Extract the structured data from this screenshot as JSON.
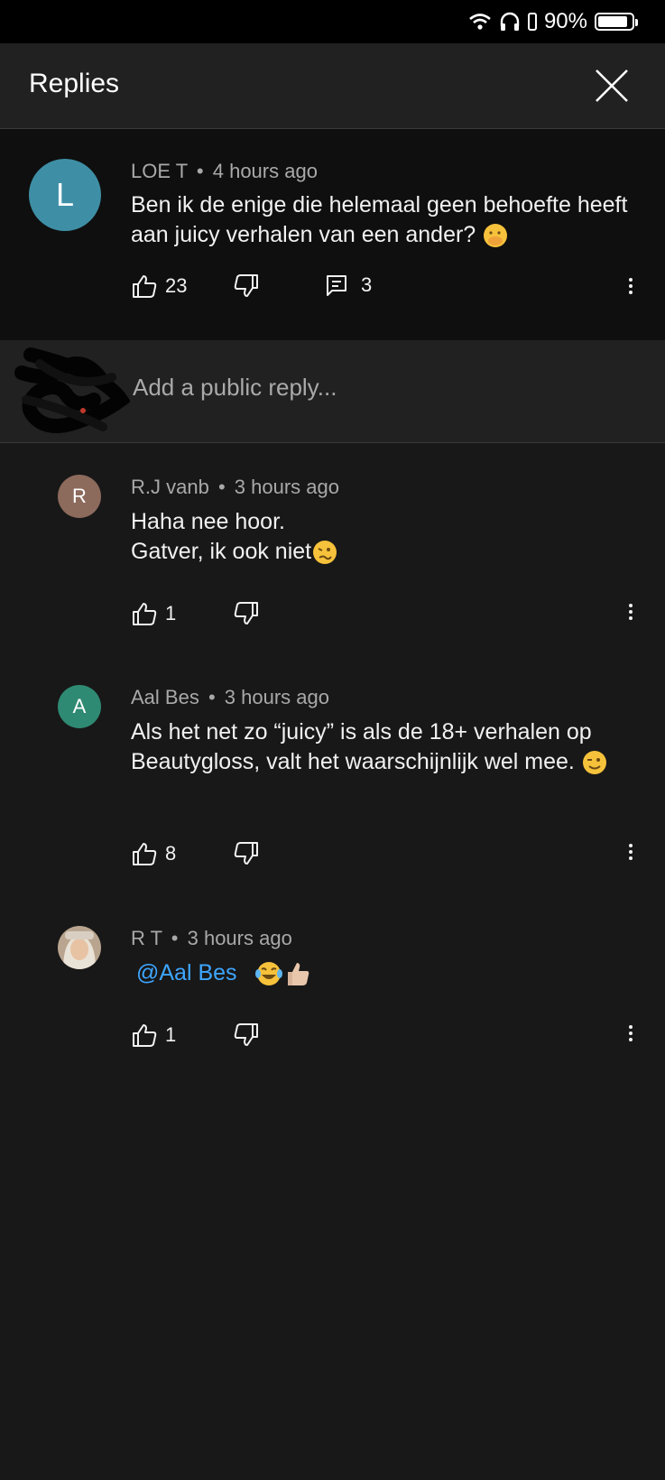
{
  "status": {
    "battery": "90%",
    "battery_level": 0.9
  },
  "header": {
    "title": "Replies"
  },
  "parent_comment": {
    "avatar_letter": "L",
    "avatar_color": "#3e8fa6",
    "author": "LOE T",
    "time": "4 hours ago",
    "text": "Ben ik de enige die helemaal geen behoefte heeft aan juicy verhalen van een ander?",
    "likes": "23",
    "replies": "3"
  },
  "reply_box": {
    "placeholder": "Add a public reply..."
  },
  "replies": [
    {
      "avatar_letter": "R",
      "avatar_color": "#8c6a5c",
      "author": "R.J vanb",
      "time": "3 hours ago",
      "line1": "Haha nee hoor.",
      "line2": "Gatver, ik ook niet",
      "likes": "1"
    },
    {
      "avatar_letter": "A",
      "avatar_color": "#2f8a73",
      "author": "Aal Bes",
      "time": "3 hours ago",
      "text": "Als het net zo “juicy” is als de 18+ verhalen op Beautygloss, valt het waarschijnlijk wel mee.",
      "likes": "8"
    },
    {
      "author": "R T",
      "time": "3 hours ago",
      "mention": "@Aal Bes",
      "likes": "1"
    }
  ],
  "icons": [
    "wifi-icon",
    "headphones-icon",
    "battery-icon",
    "close-icon",
    "thumbs-up-icon",
    "thumbs-down-icon",
    "comment-icon",
    "more-vert-icon"
  ]
}
